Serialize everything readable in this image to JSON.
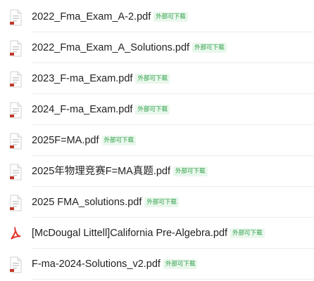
{
  "colors": {
    "badge_text": "#2e9f47",
    "badge_bg": "#e9f7ec",
    "pdf_red": "#e4332b"
  },
  "files": [
    {
      "name": "2022_Fma_Exam_A-2.pdf",
      "badge": "外部可下载",
      "icon": "document-icon"
    },
    {
      "name": "2022_Fma_Exam_A_Solutions.pdf",
      "badge": "外部可下载",
      "icon": "document-icon"
    },
    {
      "name": "2023_F-ma_Exam.pdf",
      "badge": "外部可下载",
      "icon": "document-icon"
    },
    {
      "name": "2024_F-ma_Exam.pdf",
      "badge": "外部可下载",
      "icon": "document-icon"
    },
    {
      "name": "2025F=MA.pdf",
      "badge": "外部可下载",
      "icon": "document-icon"
    },
    {
      "name": "2025年物理竞赛F=MA真题.pdf",
      "badge": "外部可下载",
      "icon": "document-icon"
    },
    {
      "name": "2025 FMA_solutions.pdf",
      "badge": "外部可下载",
      "icon": "document-icon"
    },
    {
      "name": "[McDougal Littell]California Pre-Algebra.pdf",
      "badge": "外部可下载",
      "icon": "pdf-icon"
    },
    {
      "name": "F-ma-2024-Solutions_v2.pdf",
      "badge": "外部可下载",
      "icon": "document-icon"
    }
  ]
}
